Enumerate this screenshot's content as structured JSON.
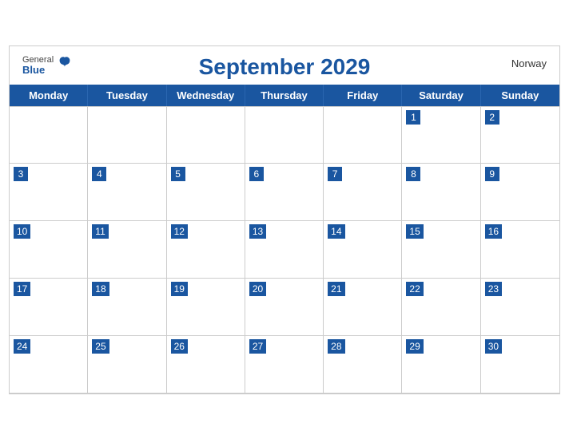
{
  "header": {
    "title": "September 2029",
    "country": "Norway",
    "logo_general": "General",
    "logo_blue": "Blue"
  },
  "days": {
    "headers": [
      "Monday",
      "Tuesday",
      "Wednesday",
      "Thursday",
      "Friday",
      "Saturday",
      "Sunday"
    ]
  },
  "weeks": [
    [
      null,
      null,
      null,
      null,
      null,
      1,
      2
    ],
    [
      3,
      4,
      5,
      6,
      7,
      8,
      9
    ],
    [
      10,
      11,
      12,
      13,
      14,
      15,
      16
    ],
    [
      17,
      18,
      19,
      20,
      21,
      22,
      23
    ],
    [
      24,
      25,
      26,
      27,
      28,
      29,
      30
    ]
  ]
}
